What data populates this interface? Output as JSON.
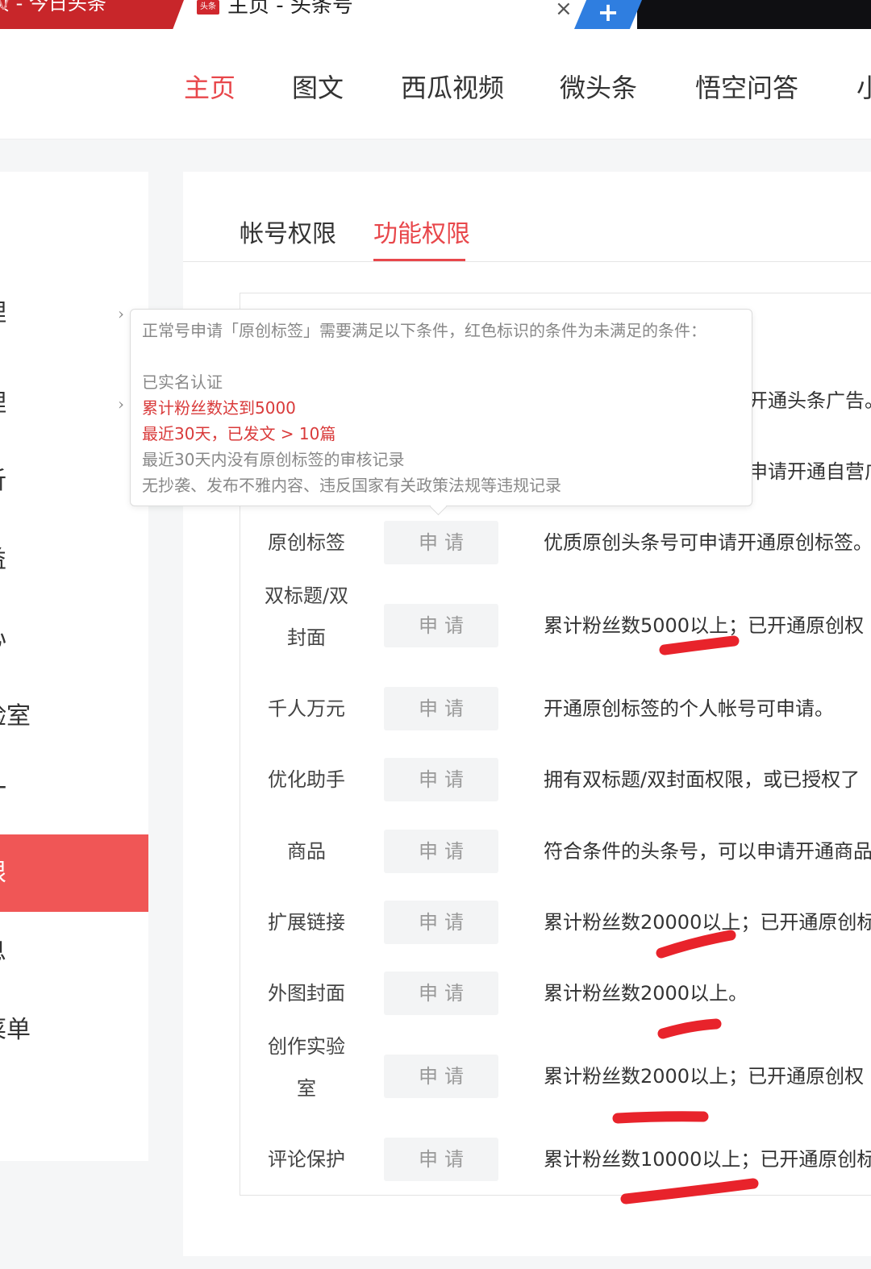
{
  "browser": {
    "inactive_tab_title": "页 - 今日头条",
    "inactive_tab_suffix": "(v",
    "active_tab_badge": "头条",
    "active_tab_title": "主页 - 头条号",
    "close_glyph": "×",
    "new_tab_glyph": "+"
  },
  "top_nav": {
    "items": [
      "主页",
      "图文",
      "西瓜视频",
      "微头条",
      "悟空问答",
      "小"
    ],
    "active_index": 0,
    "accent_color": "#e8474b"
  },
  "sidebar": {
    "items": [
      "理",
      "理",
      "析",
      "益",
      "心",
      "验室",
      "一",
      "限",
      "息",
      "菜单"
    ],
    "active_index": 7,
    "active_color": "#f05656"
  },
  "sub_tabs": {
    "items": [
      "帐号权限",
      "功能权限"
    ],
    "active_index": 1
  },
  "tooltip": {
    "intro": "正常号申请「原创标签」需要满足以下条件，红色标识的条件为未满足的条件：",
    "conditions": [
      {
        "text": "已实名认证",
        "met": true
      },
      {
        "text": "累计粉丝数达到5000",
        "met": false
      },
      {
        "text": "最近30天，已发文 > 10篇",
        "met": false
      },
      {
        "text": "最近30天内没有原创标签的审核记录",
        "met": true
      },
      {
        "text": "无抄袭、发布不雅内容、违反国家有关政策法规等违规记录",
        "met": true
      }
    ]
  },
  "permissions": {
    "apply_label": "申请",
    "partial_rows": [
      {
        "desc": "开通头条广告。"
      },
      {
        "desc": "申请开通自营广"
      }
    ],
    "rows": [
      {
        "name": "原创标签",
        "desc": "优质原创头条号可申请开通原创标签。"
      },
      {
        "name": "双标题/双封面",
        "desc": "累计粉丝数5000以上；已开通原创权"
      },
      {
        "name": "千人万元",
        "desc": "开通原创标签的个人帐号可申请。"
      },
      {
        "name": "优化助手",
        "desc": "拥有双标题/双封面权限，或已授权了"
      },
      {
        "name": "商品",
        "desc": "符合条件的头条号，可以申请开通商品"
      },
      {
        "name": "扩展链接",
        "desc": "累计粉丝数20000以上；已开通原创标"
      },
      {
        "name": "外图封面",
        "desc": "累计粉丝数2000以上。"
      },
      {
        "name": "创作实验室",
        "desc": "累计粉丝数2000以上；已开通原创权"
      },
      {
        "name": "评论保护",
        "desc": "累计粉丝数10000以上；已开通原创标"
      }
    ]
  },
  "colors": {
    "condition_unmet": "#d93a3a",
    "annotation_stroke": "#e8232b"
  }
}
